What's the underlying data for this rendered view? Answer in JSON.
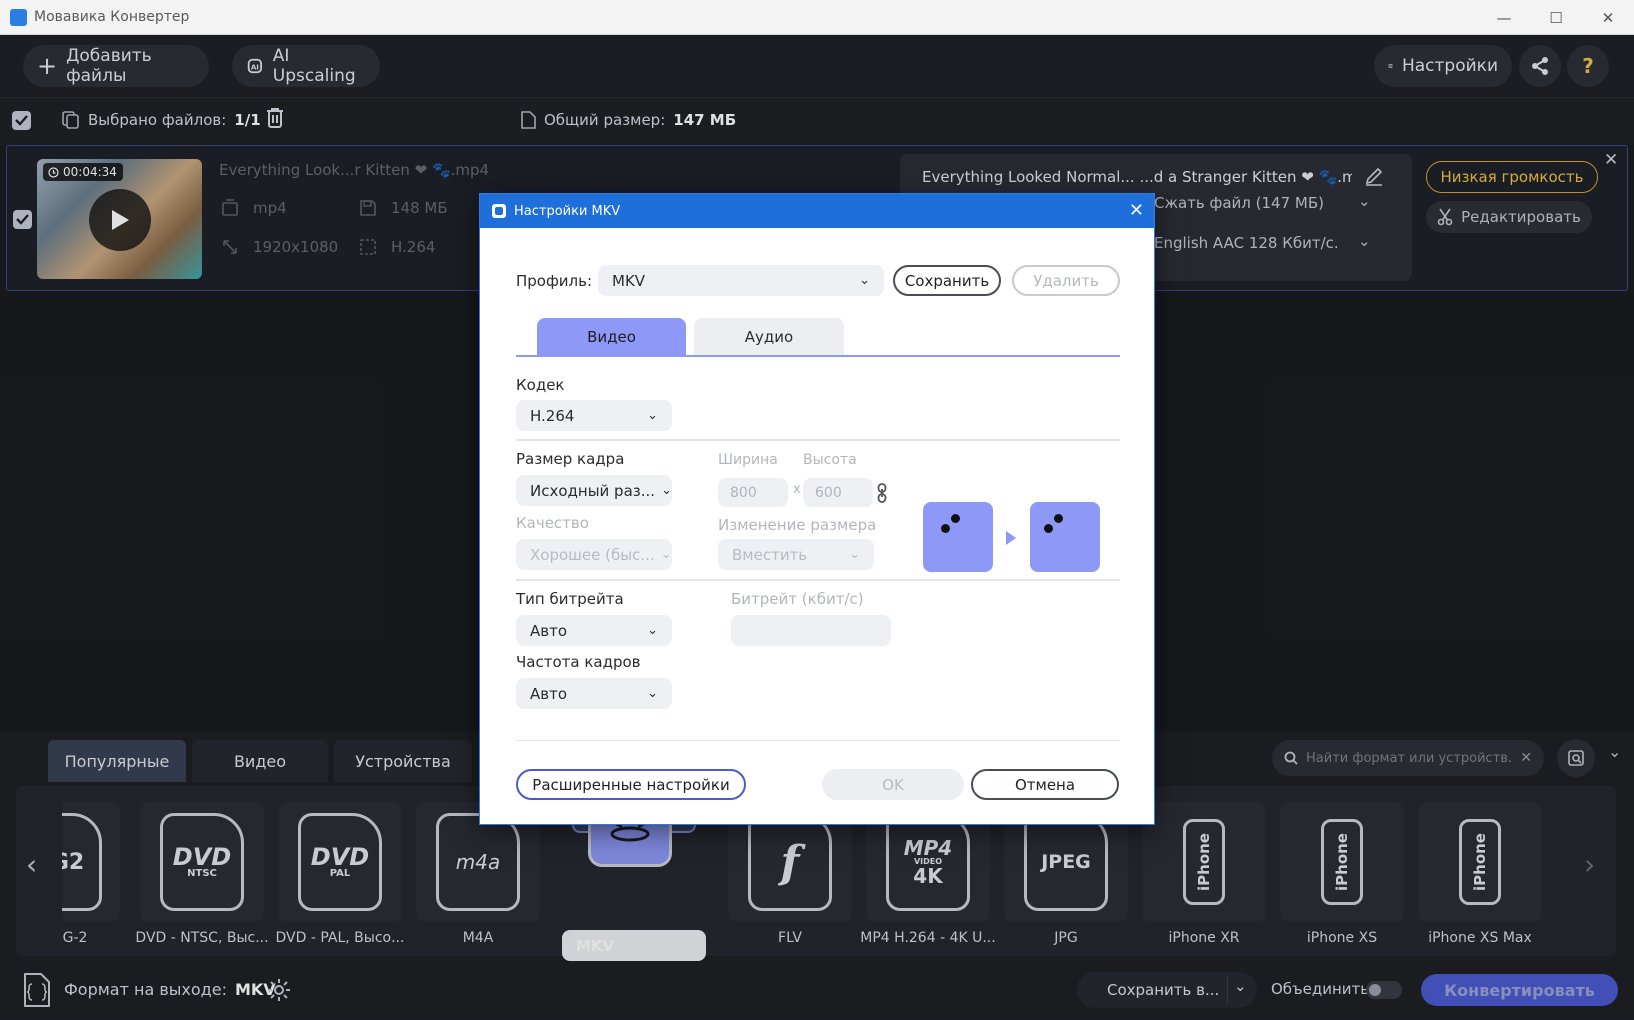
{
  "window": {
    "title": "Мовавика Конвертер"
  },
  "toolbar": {
    "add_files": "Добавить файлы",
    "ai_upscaling": "AI Upscaling",
    "settings": "Настройки",
    "help": "?"
  },
  "selection": {
    "selected_label": "Выбрано файлов:",
    "selected_value": "1/1",
    "total_label": "Общий размер:",
    "total_value": "147 МБ"
  },
  "file": {
    "duration": "00:04:34",
    "source_name": "Everything Look...r Kitten ❤ 🐾.mp4",
    "container": "mp4",
    "size": "148 МБ",
    "resolution": "1920x1080",
    "codec": "H.264",
    "output_name": "Everything Looked Normal... ...d a Stranger Kitten ❤ 🐾.mkv",
    "compress": "Сжать файл (147 МБ)",
    "audio": "English AAC 128 Кбит/с...",
    "low_volume": "Низкая громкость",
    "edit": "Редактировать"
  },
  "dialog": {
    "title": "Настройки MKV",
    "profile_label": "Профиль:",
    "profile_value": "MKV",
    "save": "Сохранить",
    "delete": "Удалить",
    "tabs": [
      "Видео",
      "Аудио"
    ],
    "codec_label": "Кодек",
    "codec_value": "H.264",
    "frame_size_label": "Размер кадра",
    "frame_size_value": "Исходный раз...",
    "width_label": "Ширина",
    "height_label": "Высота",
    "width_value": "800",
    "height_value": "600",
    "times": "x",
    "quality_label": "Качество",
    "quality_value": "Хорошее (быс...",
    "resize_label": "Изменение размера",
    "resize_value": "Вместить",
    "bitrate_type_label": "Тип битрейта",
    "bitrate_type_value": "Авто",
    "bitrate_label": "Битрейт (кбит/с)",
    "fps_label": "Частота кадров",
    "fps_value": "Авто",
    "advanced": "Расширенные настройки",
    "ok": "OK",
    "cancel": "Отмена"
  },
  "bottom": {
    "tabs": [
      "Популярные",
      "Видео",
      "Устройства"
    ],
    "search_placeholder": "Найти формат или устройств...",
    "formats": [
      {
        "label": "G-2",
        "icon": "EG2"
      },
      {
        "label": "DVD - NTSC, Выс...",
        "icon": "DVD",
        "sub": "NTSC"
      },
      {
        "label": "DVD - PAL, Высо...",
        "icon": "DVD",
        "sub": "PAL"
      },
      {
        "label": "M4A",
        "icon": "m4a"
      },
      {
        "label": "MKV",
        "icon": "mkv"
      },
      {
        "label": "FLV",
        "icon": "flash"
      },
      {
        "label": "MP4 H.264 - 4K U...",
        "icon": "MP4",
        "sub": "VIDEO",
        "sub2": "4K"
      },
      {
        "label": "JPG",
        "icon": "JPEG"
      },
      {
        "label": "iPhone XR",
        "icon": "iPhone"
      },
      {
        "label": "iPhone XS",
        "icon": "iPhone"
      },
      {
        "label": "iPhone XS Max",
        "icon": "iPhone"
      }
    ]
  },
  "footer": {
    "output_label": "Формат на выходе:",
    "output_value": "MKV",
    "save_to": "Сохранить в...",
    "merge": "Объединить:",
    "convert": "Конвертировать"
  },
  "colors": {
    "accent": "#4b5ad0",
    "dialog_title": "#1e6fd9",
    "tab_active": "#8e98f6",
    "badge": "#d8a72b"
  }
}
